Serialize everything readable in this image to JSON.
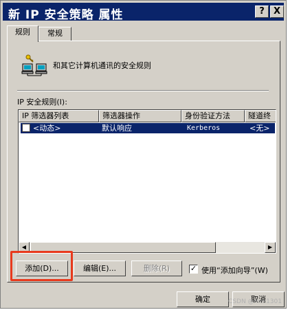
{
  "window": {
    "title": "新 IP 安全策略 属性",
    "help_label": "?",
    "close_label": "X"
  },
  "tabs": [
    {
      "label": "规则",
      "active": true
    },
    {
      "label": "常规",
      "active": false
    }
  ],
  "header": {
    "description": "和其它计算机通讯的安全规则",
    "icon": "network-computers-key-icon"
  },
  "rules_section": {
    "label": "IP 安全规则(I):"
  },
  "table": {
    "columns": [
      "IP 筛选器列表",
      "筛选器操作",
      "身份验证方法",
      "隧道终"
    ],
    "rows": [
      {
        "checked": false,
        "filter_list": "<动态>",
        "filter_action": "默认响应",
        "auth_method": "Kerberos",
        "tunnel": "<无>",
        "selected": true
      }
    ]
  },
  "buttons": {
    "add": "添加(D)...",
    "edit": "编辑(E)...",
    "delete": "删除(R)",
    "ok": "确定",
    "cancel": "取消"
  },
  "wizard": {
    "checked": true,
    "label": "使用“添加向导”(W)"
  },
  "watermark": "CSDN @mm1301"
}
